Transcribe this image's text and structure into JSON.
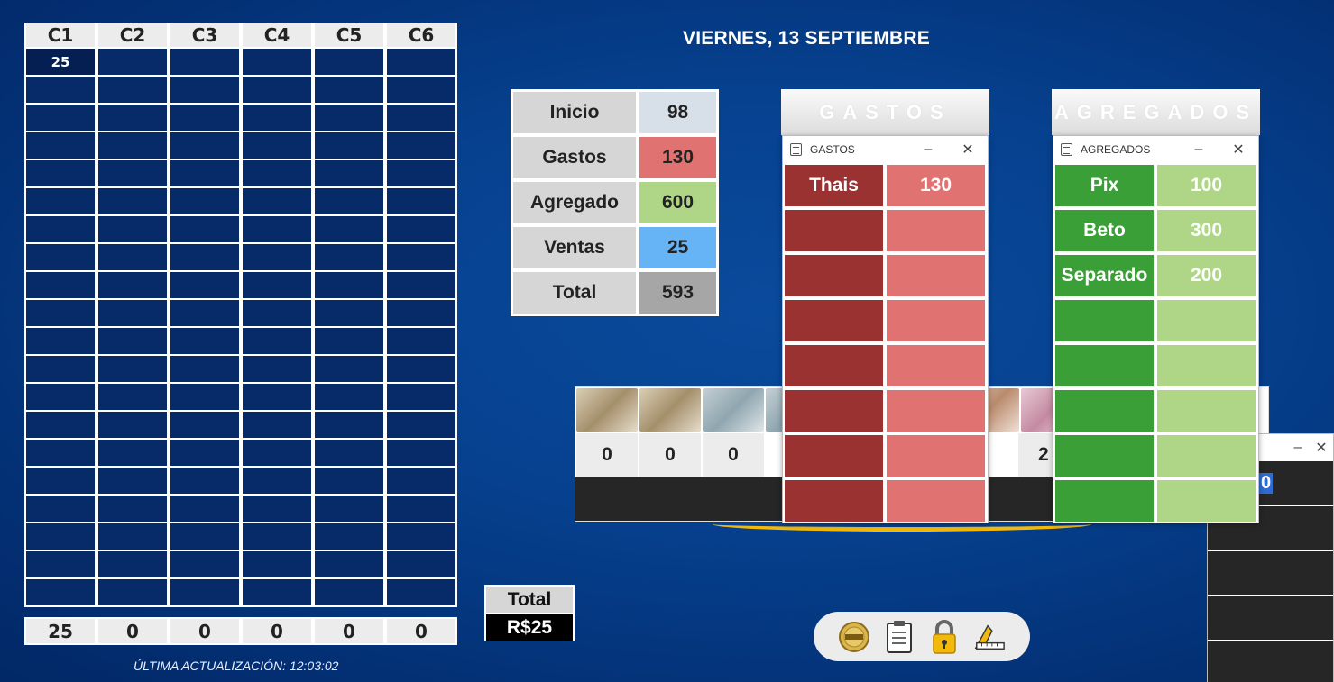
{
  "grid": {
    "headers": [
      "C1",
      "C2",
      "C3",
      "C4",
      "C5",
      "C6"
    ],
    "first_cell": "25",
    "totals": [
      "25",
      "0",
      "0",
      "0",
      "0",
      "0"
    ]
  },
  "update_text": "ÚLTIMA ACTUALIZACIÓN: 12:03:02",
  "date": "VIERNES, 13 SEPTIEMBRE",
  "summary": [
    {
      "label": "Inicio",
      "value": "98",
      "color": "#d7dfe8"
    },
    {
      "label": "Gastos",
      "value": "130",
      "color": "#e07271"
    },
    {
      "label": "Agregado",
      "value": "600",
      "color": "#aed686"
    },
    {
      "label": "Ventas",
      "value": "25",
      "color": "#66b3f5"
    },
    {
      "label": "Total",
      "value": "593",
      "color": "#a6a6a6"
    }
  ],
  "bills": {
    "counts": [
      "0",
      "0",
      "0",
      "2"
    ]
  },
  "gastos": {
    "header": "GASTOS",
    "title": "GASTOS",
    "rows": [
      {
        "k": "Thais",
        "v": "130"
      }
    ]
  },
  "agregados": {
    "header": "AGREGADOS",
    "title": "AGREGADOS",
    "rows": [
      {
        "k": "Pix",
        "v": "100"
      },
      {
        "k": "Beto",
        "v": "300"
      },
      {
        "k": "Separado",
        "v": "200"
      }
    ]
  },
  "dark_window": {
    "selected_value": "0"
  },
  "total": {
    "label": "Total",
    "value": "R$25"
  },
  "toolbar": {
    "icons": [
      "pesos-coin-icon",
      "clipboard-icon",
      "lock-icon",
      "ruler-triangle-icon"
    ]
  },
  "colors": {
    "background": "#06418f",
    "gasto_key": "#9b3232",
    "gasto_val": "#e07271",
    "agr_key": "#3a9f36",
    "agr_val": "#aed686",
    "accent_gold": "#f2b80a"
  }
}
